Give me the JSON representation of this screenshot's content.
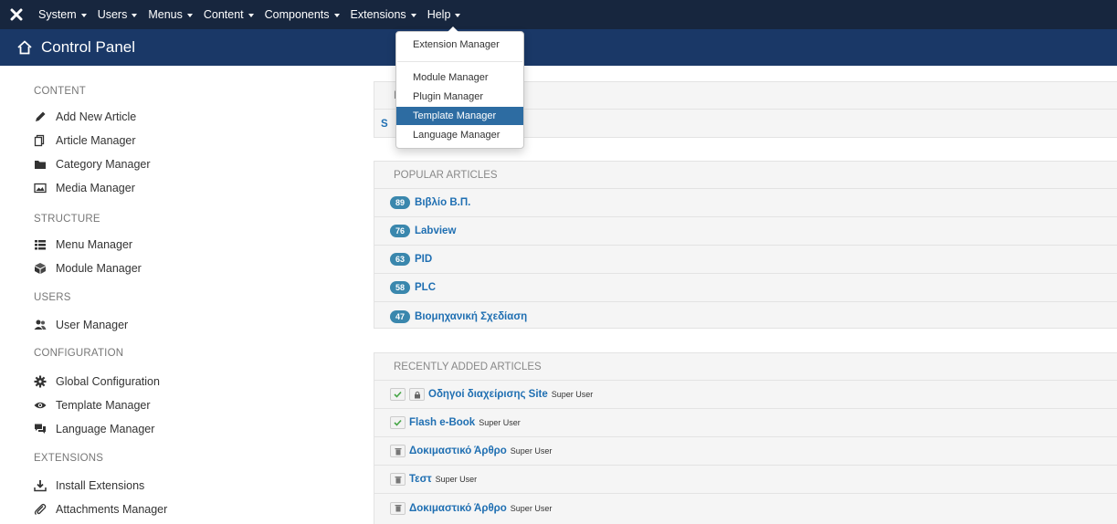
{
  "navbar": {
    "logo_icon": "joomla-logo-icon",
    "items": [
      {
        "label": "System"
      },
      {
        "label": "Users"
      },
      {
        "label": "Menus"
      },
      {
        "label": "Content"
      },
      {
        "label": "Components"
      },
      {
        "label": "Extensions"
      },
      {
        "label": "Help"
      }
    ]
  },
  "header": {
    "title": "Control Panel",
    "icon": "home-icon"
  },
  "sidebar": {
    "content_heading": "CONTENT",
    "content_items": [
      {
        "label": "Add New Article",
        "icon": "pencil-icon"
      },
      {
        "label": "Article Manager",
        "icon": "copy-icon"
      },
      {
        "label": "Category Manager",
        "icon": "folder-icon"
      },
      {
        "label": "Media Manager",
        "icon": "image-icon"
      }
    ],
    "structure_heading": "STRUCTURE",
    "structure_items": [
      {
        "label": "Menu Manager",
        "icon": "list-icon"
      },
      {
        "label": "Module Manager",
        "icon": "cube-icon"
      }
    ],
    "users_heading": "USERS",
    "users_items": [
      {
        "label": "User Manager",
        "icon": "users-icon"
      }
    ],
    "configuration_heading": "CONFIGURATION",
    "configuration_items": [
      {
        "label": "Global Configuration",
        "icon": "cog-icon"
      },
      {
        "label": "Template Manager",
        "icon": "eye-icon"
      },
      {
        "label": "Language Manager",
        "icon": "comments-icon"
      }
    ],
    "extensions_heading": "EXTENSIONS",
    "extensions_items": [
      {
        "label": "Install Extensions",
        "icon": "download-icon"
      },
      {
        "label": "Attachments Manager",
        "icon": "paperclip-icon"
      }
    ]
  },
  "dropdown": {
    "items": [
      {
        "label": "Extension Manager"
      },
      {
        "label": "Module Manager"
      },
      {
        "label": "Plugin Manager"
      },
      {
        "label": "Template Manager"
      },
      {
        "label": "Language Manager"
      }
    ]
  },
  "top_panel": {
    "heading": "L",
    "row_link": "S"
  },
  "popular": {
    "heading": "POPULAR ARTICLES",
    "rows": [
      {
        "hits": "89",
        "title": "Βιβλίο Β.Π."
      },
      {
        "hits": "76",
        "title": "Labview"
      },
      {
        "hits": "63",
        "title": "PID"
      },
      {
        "hits": "58",
        "title": "PLC"
      },
      {
        "hits": "47",
        "title": "Βιομηχανική Σχεδίαση"
      }
    ]
  },
  "recent": {
    "heading": "RECENTLY ADDED ARTICLES",
    "rows": [
      {
        "title": "Οδηγοί διαχείρισης Site",
        "author": "Super User",
        "state": "published-locked"
      },
      {
        "title": "Flash e-Book",
        "author": "Super User",
        "state": "published"
      },
      {
        "title": "Δοκιμαστικό Άρθρο",
        "author": "Super User",
        "state": "trashed"
      },
      {
        "title": "Τεστ",
        "author": "Super User",
        "state": "trashed"
      },
      {
        "title": "Δοκιμαστικό Άρθρο",
        "author": "Super User",
        "state": "trashed"
      }
    ]
  },
  "colors": {
    "navbar": "#17263e",
    "header": "#1a3867",
    "link": "#1f6fb2",
    "badge": "#3a87ad",
    "dropdown_highlight": "#2d6ca2"
  }
}
